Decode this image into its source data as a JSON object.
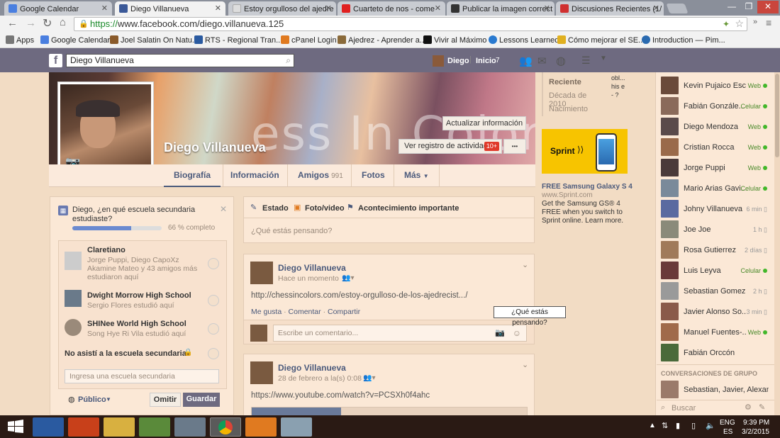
{
  "browser": {
    "tabs": [
      {
        "label": "Google Calendar",
        "color": "#4a7fe0"
      },
      {
        "label": "Diego Villanueva",
        "color": "#3b5998"
      },
      {
        "label": "Estoy orgulloso del ajedre",
        "color": "#dddddd"
      },
      {
        "label": "Cuarteto de nos - come",
        "color": "#e02020"
      },
      {
        "label": "Publicar la imagen correct",
        "color": "#333333"
      },
      {
        "label": "Discusiones Recientes (1/",
        "color": "#d03030"
      }
    ],
    "url_scheme": "https://",
    "url_rest": "www.facebook.com/diego.villanueva.125",
    "bookmarks": [
      {
        "label": "Apps",
        "color": "#777777"
      },
      {
        "label": "Google Calendar",
        "color": "#4a7fe0"
      },
      {
        "label": "Joel Salatin On Natu...",
        "color": "#8a5a2a"
      },
      {
        "label": "RTS - Regional Tran...",
        "color": "#2a5aa0"
      },
      {
        "label": "cPanel Login",
        "color": "#e07a20"
      },
      {
        "label": "Ajedrez - Aprender a...",
        "color": "#8a6a3a"
      },
      {
        "label": "Vivir al Máximo",
        "color": "#111111"
      },
      {
        "label": "Lessons Learned",
        "color": "#2a7ad0"
      },
      {
        "label": "Cómo mejorar el SE...",
        "color": "#e0b020"
      },
      {
        "label": "Introduction — Pim...",
        "color": "#2a6ab0"
      }
    ]
  },
  "fb": {
    "search_value": "Diego Villanueva",
    "user": "Diego",
    "home": "Inicio",
    "home_count": "7"
  },
  "profile": {
    "name": "Diego Villanueva",
    "cover_text": "ess In Colors",
    "update_info": "Actualizar información",
    "activity_log": "Ver registro de actividad",
    "activity_badge": "10+",
    "more_dots": "•••",
    "nav": {
      "timeline": "Biografía",
      "about": "Información",
      "friends": "Amigos",
      "friends_count": "991",
      "photos": "Fotos",
      "more": "Más"
    }
  },
  "timeline_nav": [
    "Reciente",
    "Década de 2010",
    "Nacimiento"
  ],
  "school_box": {
    "question": "Diego, ¿en qué escuela secundaria estudiaste?",
    "progress_label": "66 % completo",
    "progress": 0.66,
    "schools": [
      {
        "name": "Claretiano",
        "sub": "Jorge Puppi, Diego CapoXz Akamine Mateo y 43 amigos más estudiaron aquí"
      },
      {
        "name": "Dwight Morrow High School",
        "sub": "Sergio Flores estudió aquí"
      },
      {
        "name": "SHINee World High School",
        "sub": "Song Hye Ri Vila estudió aquí"
      }
    ],
    "no_school": "No asistí a la escuela secundaria",
    "input_placeholder": "Ingresa una escuela secundaria",
    "privacy": "Público",
    "skip": "Omitir",
    "save": "Guardar"
  },
  "composer": {
    "status": "Estado",
    "photo": "Foto/video",
    "event": "Acontecimiento importante",
    "placeholder": "¿Qué estás pensando?"
  },
  "tooltip": "¿Qué estás pensando?",
  "posts": [
    {
      "author": "Diego Villanueva",
      "time": "Hace un momento",
      "text": "http://chessincolors.com/estoy-orgulloso-de-los-ajedrecist.../",
      "like": "Me gusta",
      "comment": "Comentar",
      "share": "Compartir",
      "comment_placeholder": "Escribe un comentario..."
    },
    {
      "author": "Diego Villanueva",
      "time": "28 de febrero a la(s) 0:08",
      "text": "https://www.youtube.com/watch?v=PCSXh0f4ahc"
    }
  ],
  "ad": {
    "brand": "Sprint",
    "title": "FREE Samsung Galaxy S 4",
    "domain": "www.Sprint.com",
    "body": "Get the Samsung GS® 4 FREE when you switch to Sprint online. Learn more.",
    "side_text": "obl... his e- ?"
  },
  "chat": {
    "friends": [
      {
        "name": "Kevin Pujaico Esc...",
        "status": "Web",
        "online": true
      },
      {
        "name": "Fabián Gonzále...",
        "status": "Celular",
        "online": true
      },
      {
        "name": "Diego Mendoza",
        "status": "Web",
        "online": true
      },
      {
        "name": "Cristian Rocca",
        "status": "Web",
        "online": true
      },
      {
        "name": "Jorge Puppi",
        "status": "Web",
        "online": true
      },
      {
        "name": "Mario Arias Gavi...",
        "status": "Celular",
        "online": true
      },
      {
        "name": "Johny Villanueva",
        "status": "6 min",
        "online": false
      },
      {
        "name": "Joe Joe",
        "status": "1 h",
        "online": false
      },
      {
        "name": "Rosa Gutierrez",
        "status": "2 días",
        "online": false
      },
      {
        "name": "Luis Leyva",
        "status": "Celular",
        "online": true
      },
      {
        "name": "Sebastian Gomez ...",
        "status": "2 h",
        "online": false
      },
      {
        "name": "Javier Alonso So...",
        "status": "3 min",
        "online": false
      },
      {
        "name": "Manuel Fuentes-...",
        "status": "Web",
        "online": true
      },
      {
        "name": "Fabián Orccón",
        "status": "",
        "online": false
      }
    ],
    "group_header": "CONVERSACIONES DE GRUPO",
    "group": "Sebastian, Javier, Alexan...",
    "search": "Buscar"
  },
  "taskbar": {
    "lang1": "ENG",
    "lang2": "ES",
    "time": "9:39 PM",
    "date": "3/2/2015"
  }
}
